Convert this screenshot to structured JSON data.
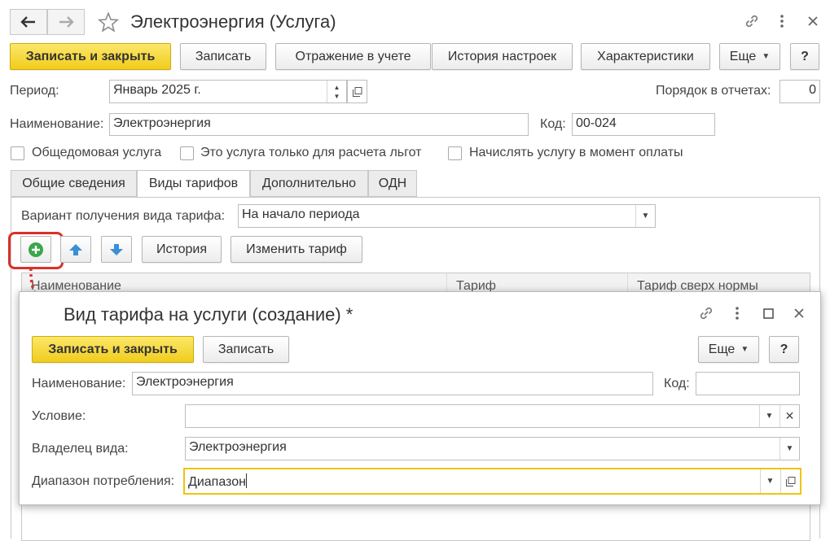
{
  "window": {
    "title": "Электроэнергия (Услуга)",
    "icons": [
      "back-arrow-icon",
      "forward-arrow-icon",
      "star-icon",
      "link-icon",
      "more-icon",
      "close-icon"
    ]
  },
  "toolbar": {
    "save_close": "Записать и закрыть",
    "save": "Записать",
    "reflection": "Отражение в учете",
    "settings_history": "История настроек",
    "characteristics": "Характеристики",
    "more": "Еще",
    "help": "?"
  },
  "form": {
    "period_label": "Период:",
    "period_value": "Январь 2025 г.",
    "order_label": "Порядок в отчетах:",
    "order_value": "0",
    "name_label": "Наименование:",
    "name_value": "Электроэнергия",
    "code_label": "Код:",
    "code_value": "00-024",
    "cb_common": "Общедомовая услуга",
    "cb_benefits": "Это услуга только для расчета льгот",
    "cb_payment": "Начислять услугу в момент оплаты"
  },
  "tabs": [
    "Общие сведения",
    "Виды тарифов",
    "Дополнительно",
    "ОДН"
  ],
  "tariff_tab": {
    "variant_label": "Вариант получения вида тарифа:",
    "variant_value": "На начало периода",
    "history_btn": "История",
    "change_btn": "Изменить тариф",
    "columns": [
      "Наименование",
      "Тариф",
      "Тариф сверх нормы"
    ]
  },
  "modal": {
    "title": "Вид тарифа на услуги (создание) *",
    "save_close": "Записать и закрыть",
    "save": "Записать",
    "more": "Еще",
    "help": "?",
    "name_label": "Наименование:",
    "name_value": "Электроэнергия",
    "code_label": "Код:",
    "code_value": "",
    "condition_label": "Условие:",
    "condition_value": "",
    "owner_label": "Владелец вида:",
    "owner_value": "Электроэнергия",
    "range_label": "Диапазон потребления:",
    "range_value": "Диапазон"
  },
  "colors": {
    "accent_yellow": "#f4d02a",
    "highlight_red": "#d9312b",
    "focus_border": "#f1c40f",
    "add_green": "#3ba64a",
    "arrow_blue": "#3a8fd6"
  }
}
